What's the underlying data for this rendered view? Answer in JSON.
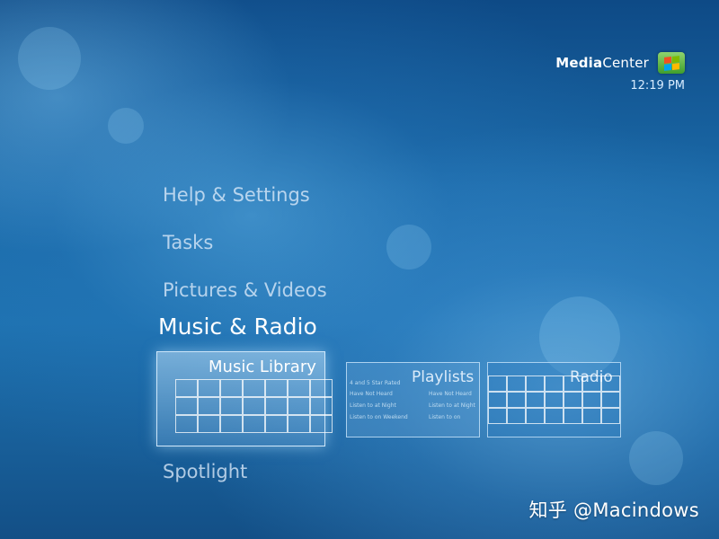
{
  "header": {
    "brand_bold": "Media",
    "brand_regular": "Center",
    "clock": "12:19 PM"
  },
  "menu": {
    "items": [
      {
        "label": "Help & Settings"
      },
      {
        "label": "Tasks"
      },
      {
        "label": "Pictures & Videos"
      },
      {
        "label": "Music & Radio",
        "active": true
      },
      {
        "label": "Spotlight"
      }
    ]
  },
  "tiles": {
    "music_library": {
      "label": "Music Library"
    },
    "playlists": {
      "label": "Playlists",
      "items_left": [
        "4 and 5 Star Rated",
        "Have Not Heard",
        "Listen to at Night",
        "Listen to on Weekend"
      ],
      "items_right": [
        "Have Not Heard",
        "Listen to at Night",
        "Listen to on"
      ]
    },
    "radio": {
      "label": "Radio"
    }
  },
  "watermark": "知乎 @Macindows",
  "colors": {
    "background": "#1b6aa8",
    "text": "#ffffff",
    "logo_green": "#3f9f2c"
  }
}
